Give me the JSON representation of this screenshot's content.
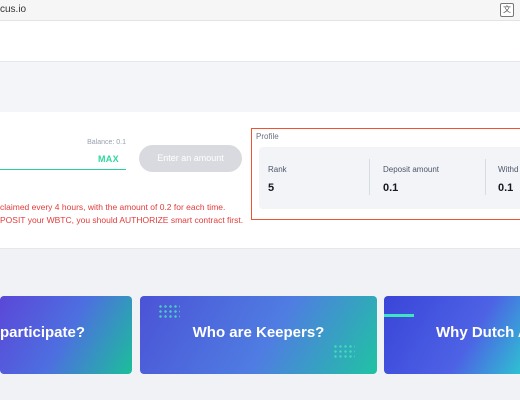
{
  "browser": {
    "url_fragment": "cus.io"
  },
  "deposit": {
    "balance_label": "Balance: 0.1",
    "max_label": "MAX",
    "button_label": "Enter an amount",
    "notes": [
      "claimed every 4 hours, with the amount of 0.2 for each time.",
      "POSIT your WBTC, you should AUTHORIZE smart contract first."
    ]
  },
  "profile": {
    "title": "Profile",
    "stats": [
      {
        "label": "Rank",
        "value": "5"
      },
      {
        "label": "Deposit amount",
        "value": "0.1"
      },
      {
        "label": "Withd",
        "value": "0.1"
      }
    ]
  },
  "banners": [
    {
      "label": "participate?"
    },
    {
      "label": "Who are Keepers?"
    },
    {
      "label": "Why Dutch A"
    }
  ],
  "colors": {
    "accent_green": "#2fd89c",
    "warning_red": "#e23b3b",
    "highlight_orange": "#f0532f"
  }
}
